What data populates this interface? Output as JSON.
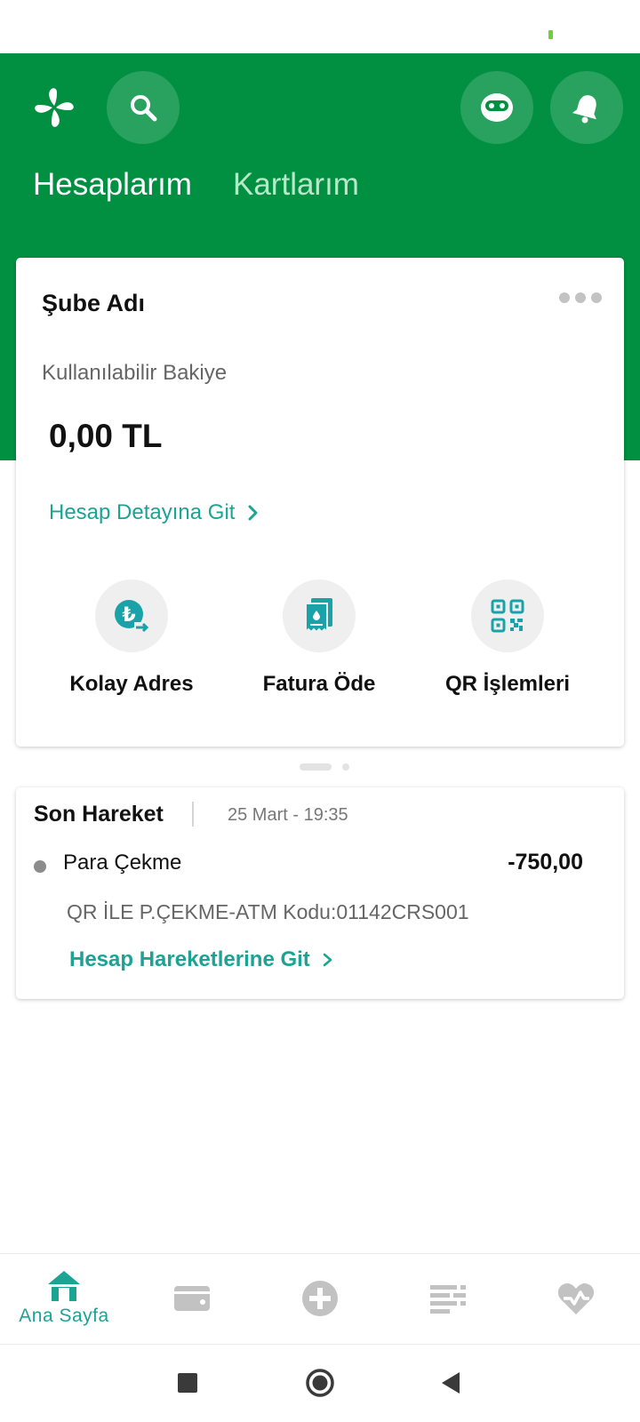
{
  "header": {
    "tabs": [
      {
        "label": "Hesaplarım",
        "active": true
      },
      {
        "label": "Kartlarım",
        "active": false
      }
    ]
  },
  "account_card": {
    "branch_name": "Şube Adı",
    "balance_label": "Kullanılabilir Bakiye",
    "balance_value": "0,00 TL",
    "detail_link": "Hesap Detayına Git",
    "quick_actions": [
      {
        "label": "Kolay Adres",
        "icon": "lira-transfer-icon"
      },
      {
        "label": "Fatura Öde",
        "icon": "bill-icon"
      },
      {
        "label": "QR İşlemleri",
        "icon": "qr-code-icon"
      }
    ]
  },
  "last_transaction": {
    "title": "Son Hareket",
    "date": "25 Mart - 19:35",
    "name": "Para Çekme",
    "amount": "-750,00",
    "description": "QR İLE P.ÇEKME-ATM Kodu:01142CRS001",
    "link": "Hesap Hareketlerine Git"
  },
  "bottom_nav": {
    "items": [
      {
        "label": "Ana Sayfa",
        "icon": "home-icon",
        "active": true
      },
      {
        "label": "",
        "icon": "wallet-icon",
        "active": false
      },
      {
        "label": "",
        "icon": "plus-circle-icon",
        "active": false
      },
      {
        "label": "",
        "icon": "list-icon",
        "active": false
      },
      {
        "label": "",
        "icon": "heart-pulse-icon",
        "active": false
      }
    ]
  },
  "colors": {
    "brand_green": "#019041",
    "accent_teal": "#1ba394",
    "inactive_gray": "#c2c2c2"
  }
}
